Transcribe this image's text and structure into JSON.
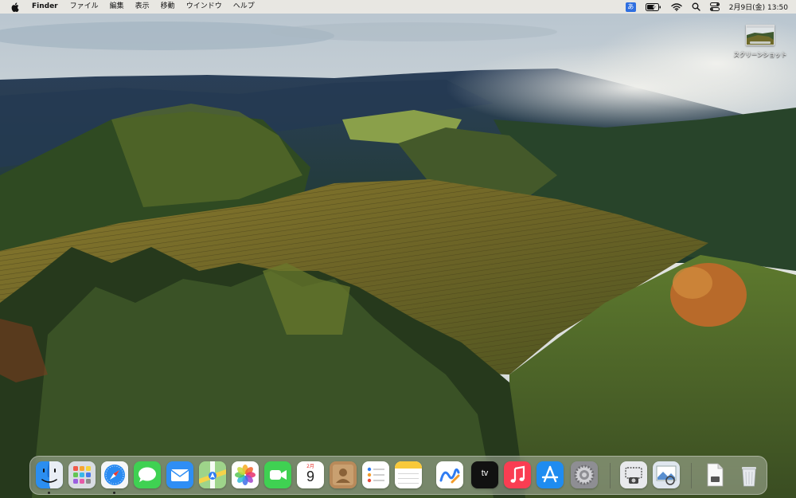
{
  "menubar": {
    "app_name": "Finder",
    "menus": [
      "ファイル",
      "編集",
      "表示",
      "移動",
      "ウインドウ",
      "ヘルプ"
    ],
    "input_method": "あ",
    "clock": "2月9日(金)  13:50",
    "icons": [
      "apple-logo-icon",
      "battery-icon",
      "wifi-icon",
      "spotlight-search-icon",
      "control-center-icon"
    ]
  },
  "desktop": {
    "icons": [
      {
        "label": "スクリーンショット"
      }
    ]
  },
  "dock": {
    "calendar": {
      "month": "2月",
      "day": "9"
    },
    "tv_label": "tv",
    "items": [
      "finder",
      "launchpad",
      "safari",
      "messages",
      "mail",
      "maps",
      "photos",
      "facetime",
      "calendar",
      "contacts",
      "reminders",
      "notes",
      "freeform",
      "apple-tv",
      "music",
      "app-store",
      "system-settings",
      "screenshot-utility",
      "preview",
      "document",
      "trash"
    ]
  },
  "colors": {
    "menubar_bg": "#ece9e4",
    "input_badge": "#2f6fe0",
    "sky": "#c9d3dc",
    "forest": "#2f4a25",
    "vineyard": "#6e6a2a"
  }
}
